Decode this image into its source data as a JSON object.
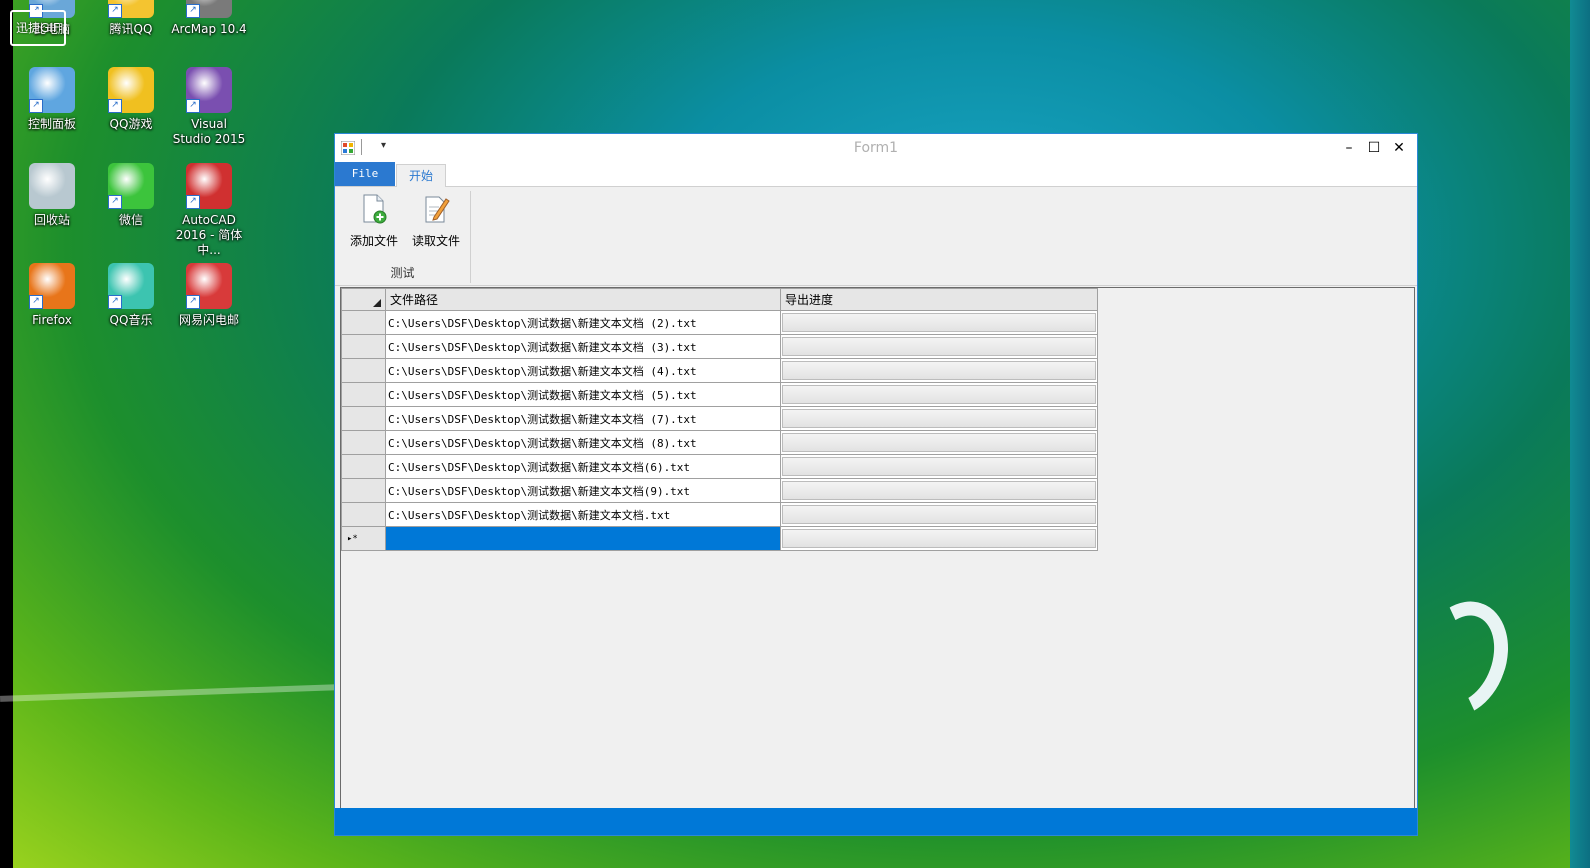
{
  "desktop": {
    "icons": [
      {
        "label": "此电脑",
        "icon": "computer-icon",
        "overlay": "迅捷GIF"
      },
      {
        "label": "腾讯QQ",
        "icon": "qq-icon"
      },
      {
        "label": "ArcMap 10.4",
        "icon": "arcmap-icon"
      },
      {
        "label": "控制面板",
        "icon": "control-panel-icon"
      },
      {
        "label": "QQ游戏",
        "icon": "qq-game-icon"
      },
      {
        "label": "Visual Studio 2015",
        "icon": "visual-studio-icon"
      },
      {
        "label": "回收站",
        "icon": "recycle-bin-icon"
      },
      {
        "label": "微信",
        "icon": "wechat-icon"
      },
      {
        "label": "AutoCAD 2016 - 简体中...",
        "icon": "autocad-icon"
      },
      {
        "label": "Firefox",
        "icon": "firefox-icon"
      },
      {
        "label": "QQ音乐",
        "icon": "qq-music-icon"
      },
      {
        "label": "网易闪电邮",
        "icon": "netease-mail-icon"
      }
    ]
  },
  "window": {
    "title": "Form1",
    "quick_access_dropdown": "▾",
    "controls": {
      "minimize": "–",
      "maximize": "☐",
      "close": "✕"
    }
  },
  "ribbon": {
    "tabs": {
      "file": "File",
      "start": "开始"
    },
    "buttons": {
      "add_file": "添加文件",
      "read_file": "读取文件"
    },
    "group_label": "测试"
  },
  "grid": {
    "columns": {
      "path": "文件路径",
      "progress": "导出进度"
    },
    "rows": [
      {
        "path": "C:\\Users\\DSF\\Desktop\\测试数据\\新建文本文档 (2).txt",
        "progress": 0
      },
      {
        "path": "C:\\Users\\DSF\\Desktop\\测试数据\\新建文本文档 (3).txt",
        "progress": 0
      },
      {
        "path": "C:\\Users\\DSF\\Desktop\\测试数据\\新建文本文档 (4).txt",
        "progress": 0
      },
      {
        "path": "C:\\Users\\DSF\\Desktop\\测试数据\\新建文本文档 (5).txt",
        "progress": 0
      },
      {
        "path": "C:\\Users\\DSF\\Desktop\\测试数据\\新建文本文档 (7).txt",
        "progress": 0
      },
      {
        "path": "C:\\Users\\DSF\\Desktop\\测试数据\\新建文本文档 (8).txt",
        "progress": 0
      },
      {
        "path": "C:\\Users\\DSF\\Desktop\\测试数据\\新建文本文档(6).txt",
        "progress": 0
      },
      {
        "path": "C:\\Users\\DSF\\Desktop\\测试数据\\新建文本文档(9).txt",
        "progress": 0
      },
      {
        "path": "C:\\Users\\DSF\\Desktop\\测试数据\\新建文本文档.txt",
        "progress": 0
      }
    ],
    "new_row_marker": "▸*"
  },
  "colors": {
    "accent": "#0078d7",
    "file_tab": "#2b79d0",
    "progress_fill": "#06b025"
  }
}
